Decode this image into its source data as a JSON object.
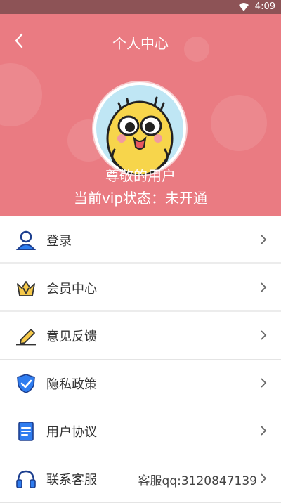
{
  "status": {
    "time": "4:09"
  },
  "header": {
    "title": "个人中心",
    "username": "尊敬的用户",
    "vip_status": "当前vip状态：未开通"
  },
  "menu": [
    {
      "label": "登录",
      "icon": "user-icon"
    },
    {
      "label": "会员中心",
      "icon": "crown-icon"
    },
    {
      "label": "意见反馈",
      "icon": "pencil-icon"
    },
    {
      "label": "隐私政策",
      "icon": "shield-check-icon"
    },
    {
      "label": "用户协议",
      "icon": "document-icon"
    },
    {
      "label": "联系客服",
      "icon": "headphones-icon",
      "extra": "客服qq:3120847139"
    }
  ],
  "colors": {
    "header_bg": "#ea7b82",
    "status_bg": "#8d5356"
  }
}
